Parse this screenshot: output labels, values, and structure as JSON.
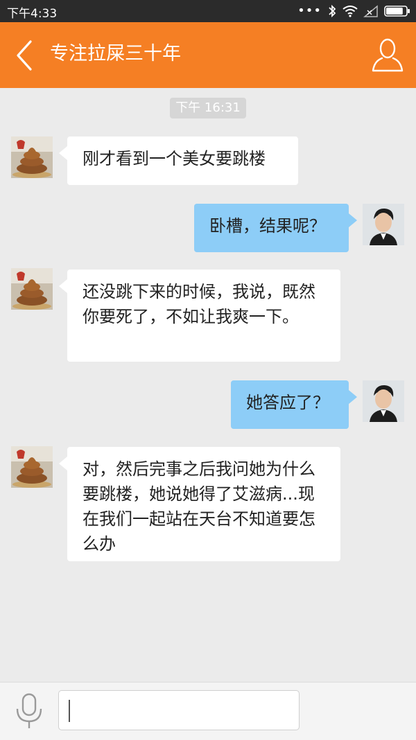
{
  "status_bar": {
    "time": "下午4:33",
    "battery_level": 0.85
  },
  "header": {
    "title": "专注拉屎三十年",
    "accent_color": "#f57f24"
  },
  "chat": {
    "timestamp": "下午 16:31",
    "messages": [
      {
        "side": "left",
        "sender": "poop-avatar",
        "text": "刚才看到一个美女要跳楼"
      },
      {
        "side": "right",
        "sender": "man-avatar",
        "text": "卧槽，结果呢？"
      },
      {
        "side": "left",
        "sender": "poop-avatar",
        "text": "还没跳下来的时候，我说，既然你要死了，不如让我爽一下。"
      },
      {
        "side": "right",
        "sender": "man-avatar",
        "text": "她答应了？"
      },
      {
        "side": "left",
        "sender": "poop-avatar",
        "text": "对，然后完事之后我问她为什么要跳楼，她说她得了艾滋病...现在我们一起站在天台不知道要怎么办"
      }
    ]
  },
  "input_bar": {
    "input_value": "",
    "mic_icon": "microphone-icon"
  },
  "colors": {
    "left_bubble": "#ffffff",
    "right_bubble": "#8dcdf7",
    "background": "#ebebeb"
  }
}
